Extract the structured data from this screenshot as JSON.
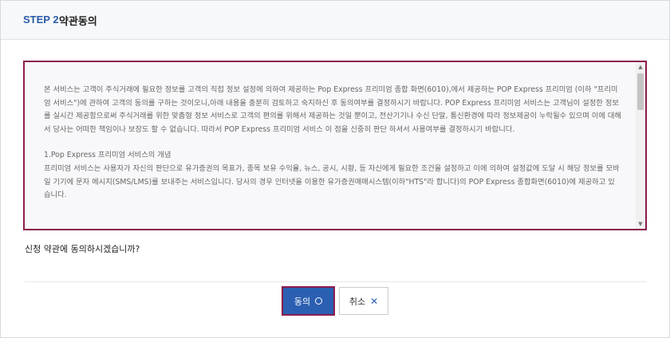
{
  "header": {
    "step": "STEP 2",
    "title": "약관동의"
  },
  "terms": {
    "paragraphs": [
      "본 서비스는 고객이 주식거래에 필요한 정보를 고객의 직접 정보 설정에 의하여 제공하는 Pop Express 프리미엄 종합 화면(6010),에서 제공하는 POP Express 프리미엄 (이하 \"프리미엄 서비스\")에 관하여 고객의 동의를 구하는 것이오니,아래 내용을 충분히 검토하고 숙지하신 후 동의여부를 결정하시기 바랍니다. POP Express 프리미엄 서비스는 고객님이 설정한 정보를 실시간 제공함으로써 주식거래를 위한 맞춤형 정보 서비스로 고객의 편의를 위해서 제공하는 것일 뿐이고, 전산기기나 수신 단말, 통신환경에 따라 정보제공이 누락될수 있으며 이에 대해서 당사는 어떠한 책임이나 보장도 할 수 없습니다. 따라서 POP Express 프리미엄 서비스 이 점을 신중히 판단 하셔서 사용여부를 결정하시기 바랍니다.",
      "1.Pop Express 프리미엄 서비스의 개념",
      "프리미엄 서비스는 사용자가 자신의 판단으로 유가증권의 목표가, 종목 보유 수익율, 뉴스, 공시, 시황, 등 자신에게 필요한 조건을 설정하고 이에 의하여 설정값에 도달 시 해당 정보를 모바일 기기에 문자 메시지(SMS/LMS)를 보내주는 서비스입니다. 당사의 경우 인터넷을 이용한 유가증권매매시스템(이하\"HTS\"라 합니다)의 POP Express 종합화면(6010)에 제공하고 있습니다."
    ]
  },
  "question": "신청 약관에 동의하시겠습니까?",
  "buttons": {
    "agree_label": "동의",
    "cancel_label": "취소"
  },
  "icons": {
    "agree": "circle-icon",
    "cancel": "close-icon",
    "scroll_up": "arrow-up-icon",
    "scroll_down": "arrow-down-icon"
  },
  "colors": {
    "accent": "#2b5fb1",
    "highlight_border": "#8c1b4e"
  }
}
